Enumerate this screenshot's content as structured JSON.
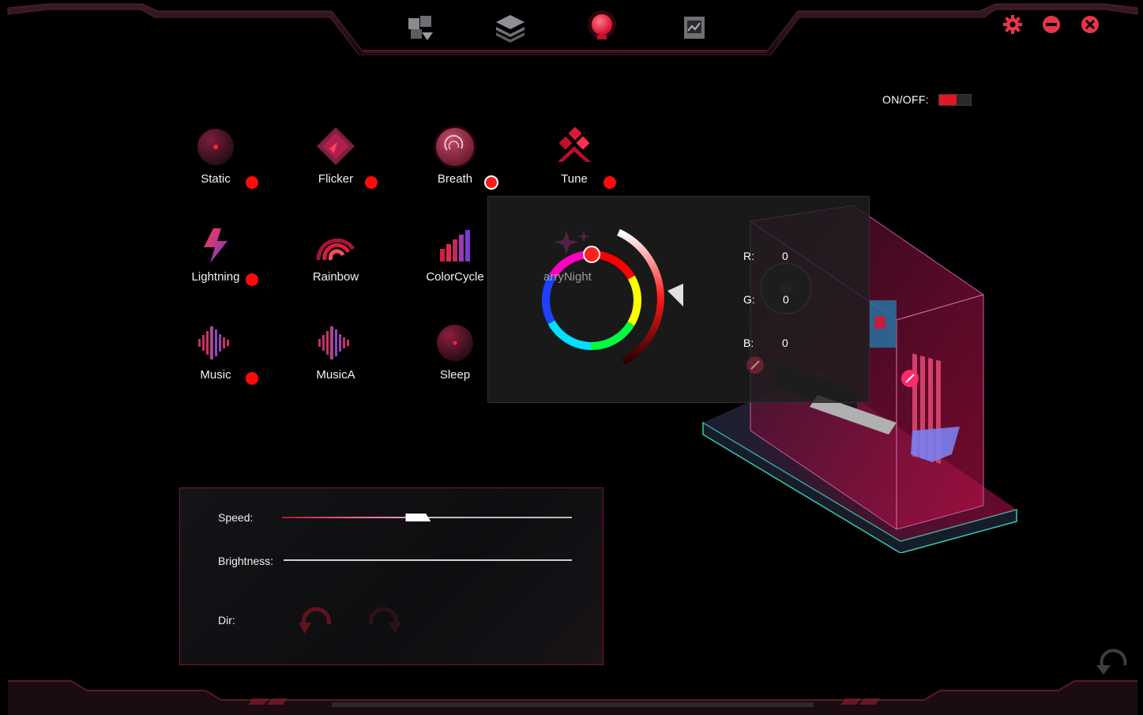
{
  "nav": {
    "tabs": [
      {
        "name": "profile-tab",
        "icon": "puzzle-arrow-icon"
      },
      {
        "name": "layers-tab",
        "icon": "layers-icon"
      },
      {
        "name": "lighting-tab",
        "icon": "bulb-icon",
        "active": true
      },
      {
        "name": "monitor-tab",
        "icon": "chart-icon"
      }
    ],
    "window": {
      "settings_icon": "gear-icon",
      "minimize_icon": "minus-icon",
      "close_icon": "close-icon"
    }
  },
  "power": {
    "label": "ON/OFF:",
    "state": "on"
  },
  "effects": [
    {
      "label": "Static",
      "icon": "static-icon",
      "dot": true
    },
    {
      "label": "Flicker",
      "icon": "flicker-icon",
      "dot": true
    },
    {
      "label": "Breath",
      "icon": "breath-icon",
      "dot": true,
      "selected": true
    },
    {
      "label": "Tune",
      "icon": "tune-icon",
      "dot": true
    },
    {
      "label": "Lightning",
      "icon": "lightning-icon",
      "dot": true
    },
    {
      "label": "Rainbow",
      "icon": "rainbow-icon",
      "dot": false
    },
    {
      "label": "ColorCycle",
      "icon": "colorcycle-icon",
      "dot": false
    },
    {
      "label": "Music",
      "icon": "music-icon",
      "dot": true
    },
    {
      "label": "MusicA",
      "icon": "musica-icon",
      "dot": false
    },
    {
      "label": "Sleep",
      "icon": "sleep-icon",
      "dot": false
    }
  ],
  "color_picker": {
    "hidden_effect_label": "StarryNight",
    "visible_effect_label": "arryNight",
    "r_label": "R:",
    "r_value": "0",
    "g_label": "G:",
    "g_value": "0",
    "b_label": "B:",
    "b_value": "0"
  },
  "controls": {
    "speed_label": "Speed:",
    "speed_value": 0.47,
    "brightness_label": "Brightness:",
    "brightness_value": 1.0,
    "dir_label": "Dir:"
  },
  "colors": {
    "accent": "#ff0b0b",
    "panel_border": "#7a1630",
    "background": "#000000"
  }
}
